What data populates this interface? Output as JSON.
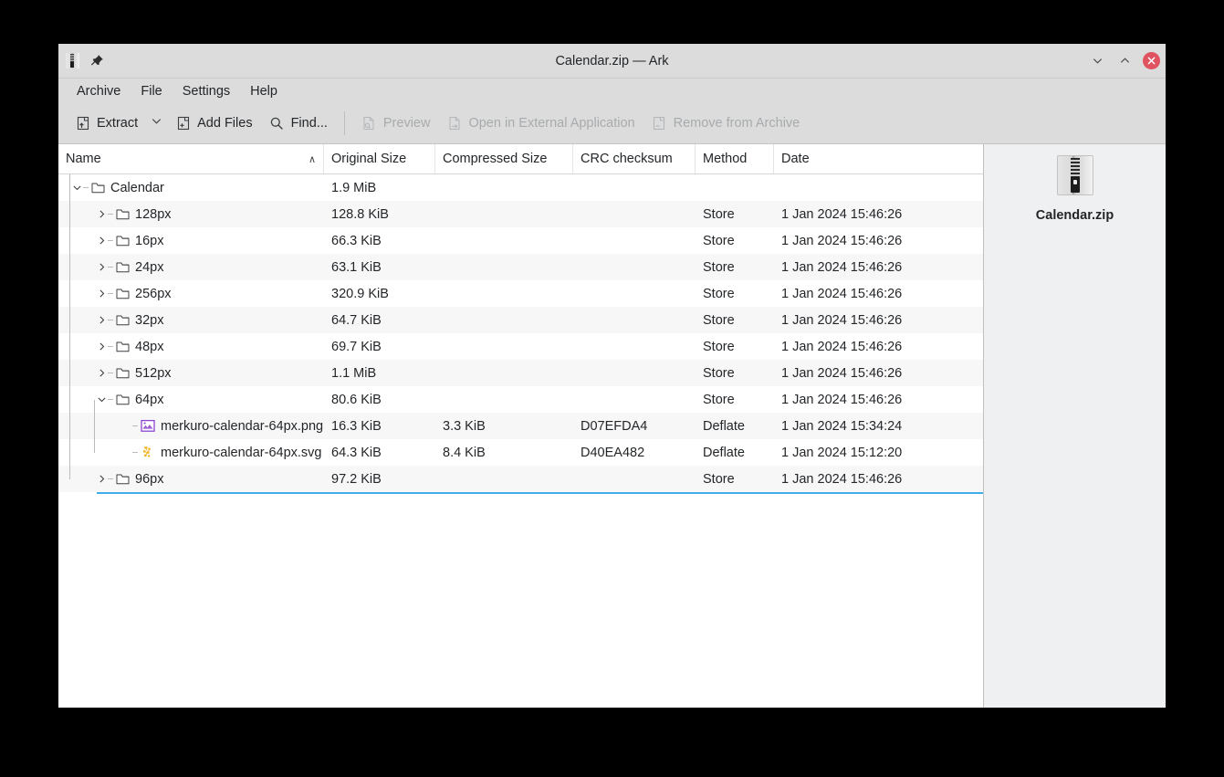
{
  "window": {
    "title": "Calendar.zip — Ark",
    "icon": "zip-archive-icon",
    "pin_icon": "pin-icon",
    "minimize_icon": "chevron-down-icon",
    "maximize_icon": "chevron-up-icon",
    "close_icon": "close-icon",
    "close_color": "#e05260"
  },
  "menubar": {
    "items": [
      {
        "label": "Archive"
      },
      {
        "label": "File"
      },
      {
        "label": "Settings"
      },
      {
        "label": "Help"
      }
    ]
  },
  "toolbar": {
    "extract_label": "Extract",
    "extract_dropdown_icon": "chevron-down-icon",
    "add_files_label": "Add Files",
    "find_label": "Find...",
    "preview_label": "Preview",
    "open_external_label": "Open in External Application",
    "remove_label": "Remove from Archive"
  },
  "table": {
    "columns": [
      {
        "label": "Name",
        "sort": "∧"
      },
      {
        "label": "Original Size"
      },
      {
        "label": "Compressed Size"
      },
      {
        "label": "CRC checksum"
      },
      {
        "label": "Method"
      },
      {
        "label": "Date"
      }
    ],
    "rows": [
      {
        "name": "Calendar",
        "depth": 0,
        "type": "folder",
        "expanded": true,
        "original_size": "1.9 MiB",
        "compressed_size": "",
        "crc": "",
        "method": "",
        "date": ""
      },
      {
        "name": "128px",
        "depth": 1,
        "type": "folder",
        "expanded": false,
        "original_size": "128.8 KiB",
        "compressed_size": "",
        "crc": "",
        "method": "Store",
        "date": "1 Jan 2024 15:46:26"
      },
      {
        "name": "16px",
        "depth": 1,
        "type": "folder",
        "expanded": false,
        "original_size": "66.3 KiB",
        "compressed_size": "",
        "crc": "",
        "method": "Store",
        "date": "1 Jan 2024 15:46:26"
      },
      {
        "name": "24px",
        "depth": 1,
        "type": "folder",
        "expanded": false,
        "original_size": "63.1 KiB",
        "compressed_size": "",
        "crc": "",
        "method": "Store",
        "date": "1 Jan 2024 15:46:26"
      },
      {
        "name": "256px",
        "depth": 1,
        "type": "folder",
        "expanded": false,
        "original_size": "320.9 KiB",
        "compressed_size": "",
        "crc": "",
        "method": "Store",
        "date": "1 Jan 2024 15:46:26"
      },
      {
        "name": "32px",
        "depth": 1,
        "type": "folder",
        "expanded": false,
        "original_size": "64.7 KiB",
        "compressed_size": "",
        "crc": "",
        "method": "Store",
        "date": "1 Jan 2024 15:46:26"
      },
      {
        "name": "48px",
        "depth": 1,
        "type": "folder",
        "expanded": false,
        "original_size": "69.7 KiB",
        "compressed_size": "",
        "crc": "",
        "method": "Store",
        "date": "1 Jan 2024 15:46:26"
      },
      {
        "name": "512px",
        "depth": 1,
        "type": "folder",
        "expanded": false,
        "original_size": "1.1 MiB",
        "compressed_size": "",
        "crc": "",
        "method": "Store",
        "date": "1 Jan 2024 15:46:26"
      },
      {
        "name": "64px",
        "depth": 1,
        "type": "folder",
        "expanded": true,
        "original_size": "80.6 KiB",
        "compressed_size": "",
        "crc": "",
        "method": "Store",
        "date": "1 Jan 2024 15:46:26"
      },
      {
        "name": "merkuro-calendar-64px.png",
        "depth": 2,
        "type": "png",
        "original_size": "16.3 KiB",
        "compressed_size": "3.3 KiB",
        "crc": "D07EFDA4",
        "method": "Deflate",
        "date": "1 Jan 2024 15:34:24"
      },
      {
        "name": "merkuro-calendar-64px.svg",
        "depth": 2,
        "type": "svg",
        "original_size": "64.3 KiB",
        "compressed_size": "8.4 KiB",
        "crc": "D40EA482",
        "method": "Deflate",
        "date": "1 Jan 2024 15:12:20"
      },
      {
        "name": "96px",
        "depth": 1,
        "type": "folder",
        "expanded": false,
        "original_size": "97.2 KiB",
        "compressed_size": "",
        "crc": "",
        "method": "Store",
        "date": "1 Jan 2024 15:46:26"
      }
    ],
    "drop_indicator_color": "#3daee9"
  },
  "sidebar": {
    "archive_name": "Calendar.zip",
    "archive_icon": "zip-archive-icon"
  },
  "colors": {
    "chrome": "#dcdcdc",
    "panel": "#eff0f1",
    "list_bg": "#ffffff",
    "alt_row": "#f7f7f8",
    "text": "#232629",
    "disabled_text": "#a8abad",
    "accent": "#3daee9",
    "png_icon": "#8e44d0",
    "svg_icon": "#f0b429"
  }
}
